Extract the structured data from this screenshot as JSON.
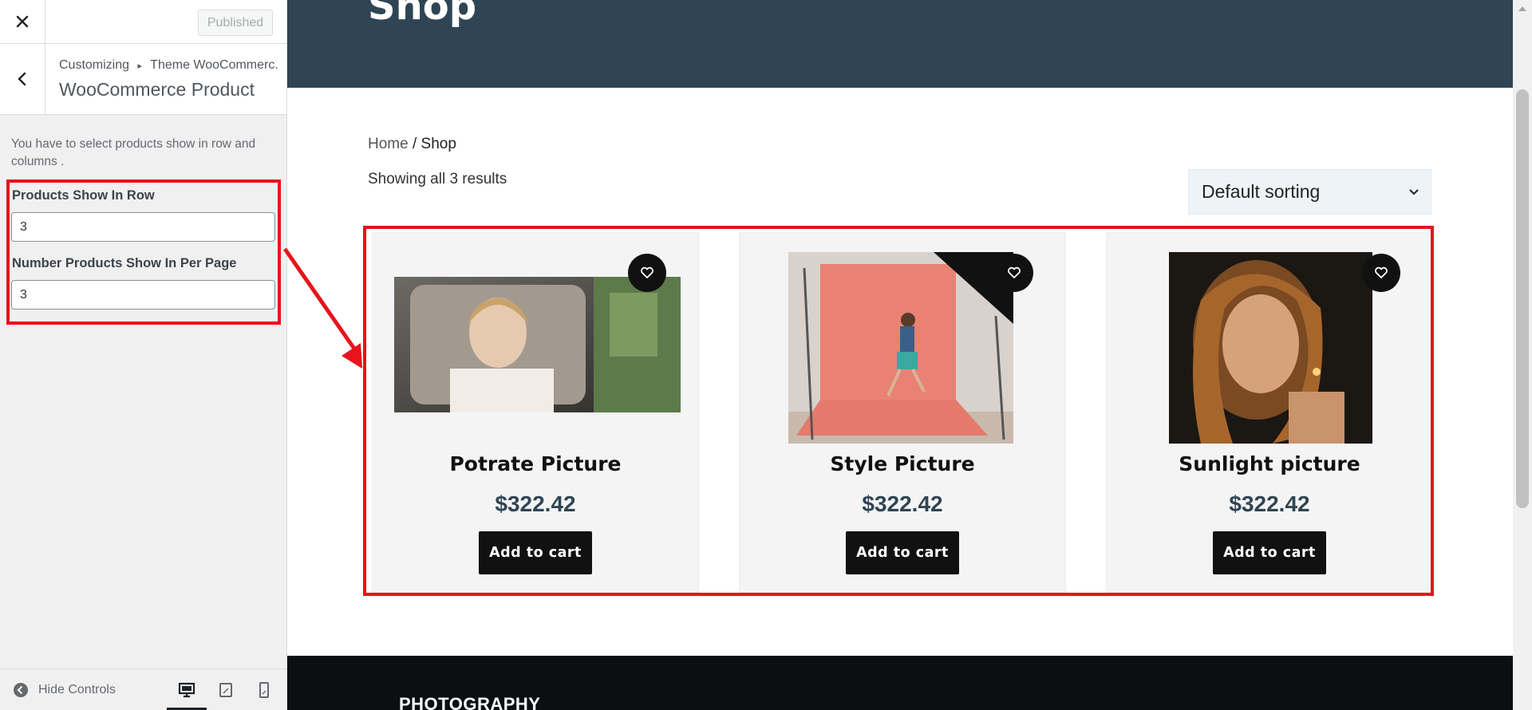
{
  "customizer": {
    "publish_label": "Published",
    "breadcrumb_root": "Customizing",
    "breadcrumb_separator": "▸",
    "breadcrumb_parent": "Theme WooCommerc...",
    "section_title": "WooCommerce Product",
    "description": "You have to select products show in row and columns .",
    "controls": [
      {
        "label": "Products Show In Row",
        "value": "3"
      },
      {
        "label": "Number Products Show In Per Page",
        "value": "3"
      }
    ],
    "footer": {
      "hide_controls_label": "Hide Controls",
      "active_device": "desktop"
    }
  },
  "preview": {
    "hero_title": "Shop",
    "breadcrumb": {
      "home": "Home",
      "separator": " / ",
      "current": "Shop"
    },
    "result_count": "Showing all 3 results",
    "sorting": {
      "selected": "Default sorting"
    },
    "products": [
      {
        "title": "Potrate Picture",
        "price": "$322.42",
        "button": "Add to cart"
      },
      {
        "title": "Style Picture",
        "price": "$322.42",
        "button": "Add to cart"
      },
      {
        "title": "Sunlight picture",
        "price": "$322.42",
        "button": "Add to cart"
      }
    ],
    "footer_heading": "PHOTOGRAPHY"
  },
  "colors": {
    "hero_bg": "#2f4554",
    "price": "#2f4554",
    "highlight": "#e8131c",
    "button_bg": "#111111",
    "footer_bg": "#0b0f12"
  },
  "icons": [
    "close-icon",
    "chevron-left-icon",
    "hide-controls-icon",
    "desktop-icon",
    "tablet-icon",
    "mobile-icon",
    "heart-icon",
    "chevron-down-icon"
  ]
}
